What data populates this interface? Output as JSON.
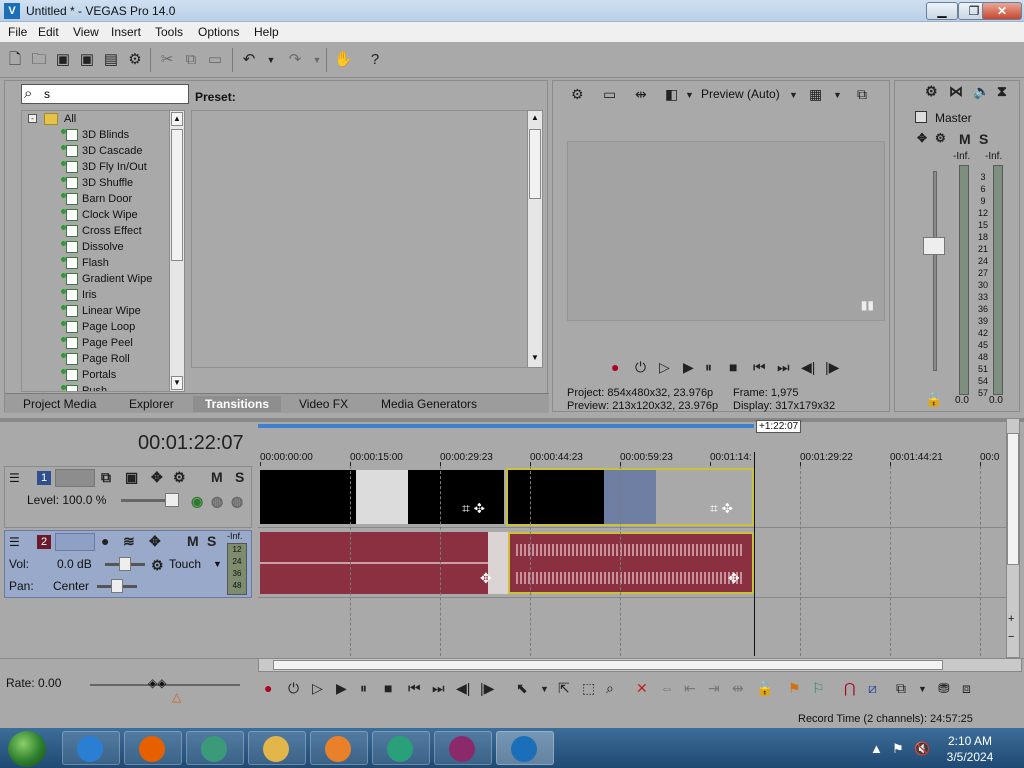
{
  "window": {
    "title": "Untitled * - VEGAS Pro 14.0",
    "logo": "vegas-logo",
    "minimize": "▁",
    "maximize": "❐",
    "close": "✕"
  },
  "menu": [
    "File",
    "Edit",
    "View",
    "Insert",
    "Tools",
    "Options",
    "Help"
  ],
  "explorer": {
    "search_value": "s",
    "preset_label": "Preset:",
    "tree_root": "All",
    "tree_items": [
      "3D Blinds",
      "3D Cascade",
      "3D Fly In/Out",
      "3D Shuffle",
      "Barn Door",
      "Clock Wipe",
      "Cross Effect",
      "Dissolve",
      "Flash",
      "Gradient Wipe",
      "Iris",
      "Linear Wipe",
      "Page Loop",
      "Page Peel",
      "Page Roll",
      "Portals",
      "Push"
    ],
    "tabs": [
      "Project Media",
      "Explorer",
      "Transitions",
      "Video FX",
      "Media Generators"
    ],
    "active_tab": "Transitions"
  },
  "preview": {
    "mode": "Preview (Auto)",
    "project_label": "Project:",
    "project_value": "854x480x32, 23.976p",
    "preview_label": "Preview:",
    "preview_value": "213x120x32, 23.976p",
    "frame_label": "Frame:",
    "frame_value": "1,975",
    "display_label": "Display:",
    "display_value": "317x179x32"
  },
  "mixer": {
    "master_label": "Master",
    "inf_left": "-Inf.",
    "inf_right": "-Inf.",
    "scale": [
      "3",
      "6",
      "9",
      "12",
      "15",
      "18",
      "21",
      "24",
      "27",
      "30",
      "33",
      "36",
      "39",
      "42",
      "45",
      "48",
      "51",
      "54",
      "57"
    ],
    "bottom_left": "0.0",
    "bottom_right": "0.0"
  },
  "timeline": {
    "time": "00:01:22:07",
    "end_marker": "+1:22:07",
    "ruler": [
      "00:00:00:00",
      "00:00:15:00",
      "00:00:29:23",
      "00:00:44:23",
      "00:00:59:23",
      "00:01:14:",
      "00:01:29:22",
      "00:01:44:21",
      "00:0"
    ],
    "track1": {
      "number": "1",
      "level_label": "Level: 100.0 %"
    },
    "track2": {
      "number": "2",
      "vol_label": "Vol:",
      "vol_value": "0.0 dB",
      "pan_label": "Pan:",
      "pan_value": "Center",
      "touch": "Touch",
      "inf": "-Inf.",
      "meter_scale": [
        "12",
        "24",
        "36",
        "48"
      ]
    },
    "mute": "M",
    "solo": "S"
  },
  "bottom": {
    "rate": "Rate: 0.00",
    "record_time": "Record Time (2 channels): 24:57:25"
  },
  "taskbar": {
    "time": "2:10 AM",
    "date": "3/5/2024"
  },
  "colors": {
    "panel": "#a9a9a9",
    "audio_clip": "#8a3040",
    "video_black": "#000000",
    "selected_track": "#99a9c9"
  }
}
